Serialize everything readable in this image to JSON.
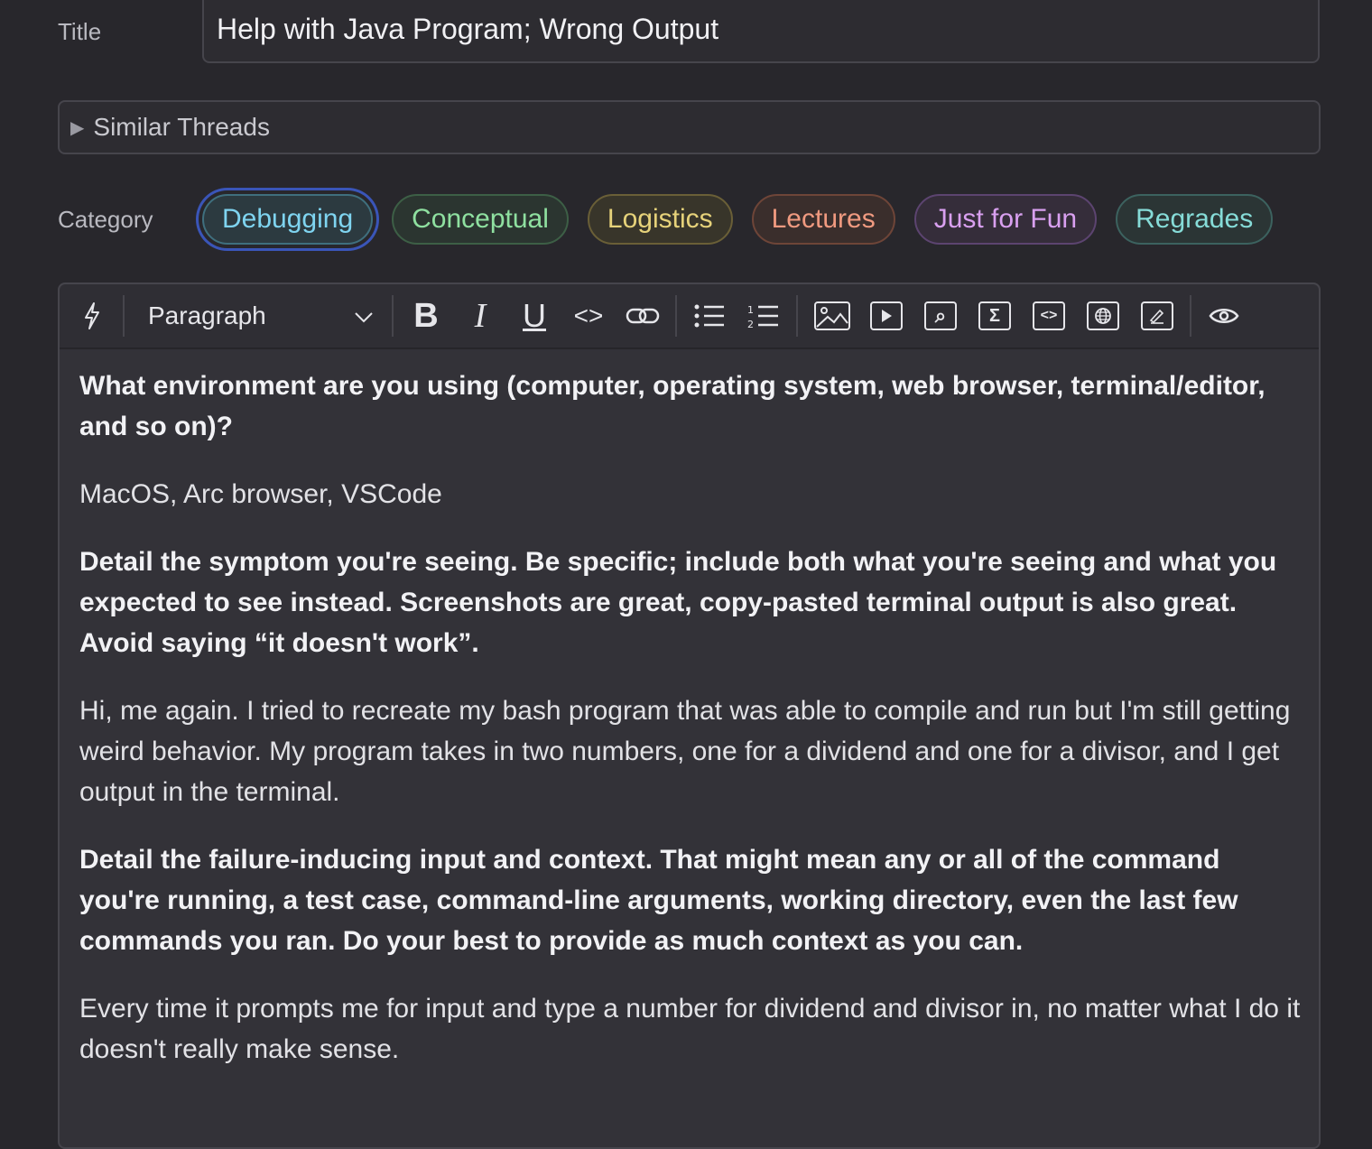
{
  "form": {
    "title_label": "Title",
    "title_value": "Help with Java Program; Wrong Output",
    "similar_threads": "Similar Threads",
    "category_label": "Category"
  },
  "categories": [
    {
      "label": "Debugging",
      "selected": true,
      "color": "#7fd4f0"
    },
    {
      "label": "Conceptual",
      "selected": false,
      "color": "#8fe0a0"
    },
    {
      "label": "Logistics",
      "selected": false,
      "color": "#e6d27a"
    },
    {
      "label": "Lectures",
      "selected": false,
      "color": "#f09a80"
    },
    {
      "label": "Just for Fun",
      "selected": false,
      "color": "#d9a0f0"
    },
    {
      "label": "Regrades",
      "selected": false,
      "color": "#86dcd8"
    }
  ],
  "toolbar": {
    "block_format": "Paragraph",
    "icons": [
      "lightning-icon",
      "bold-icon",
      "italic-icon",
      "underline-icon",
      "code-icon",
      "link-icon",
      "bullet-list-icon",
      "numbered-list-icon",
      "image-icon",
      "video-icon",
      "attachment-icon",
      "math-icon",
      "code-block-icon",
      "web-embed-icon",
      "drawing-icon",
      "preview-icon"
    ]
  },
  "body": {
    "q1": "What environment are you using (computer, operating system, web browser, terminal/editor, and so on)?",
    "a1": "MacOS, Arc browser, VSCode",
    "q2": "Detail the symptom you're seeing. Be specific; include both what you're seeing and what you expected to see instead. Screenshots are great, copy-pasted terminal output is also great. Avoid saying “it doesn't work”.",
    "a2": "Hi, me again. I tried to recreate my bash program that was able to compile and run but I'm still getting weird behavior. My program takes in two numbers, one for a dividend and one for a divisor, and I get output in the terminal.",
    "q3": "Detail the failure-inducing input and context. That might mean any or all of the command you're running, a test case, command-line arguments, working directory, even the last few commands you ran. Do your best to provide as much context as you can.",
    "a3": "Every time it prompts me for input and type a number for dividend and divisor in, no matter what I do it doesn't really make sense."
  }
}
